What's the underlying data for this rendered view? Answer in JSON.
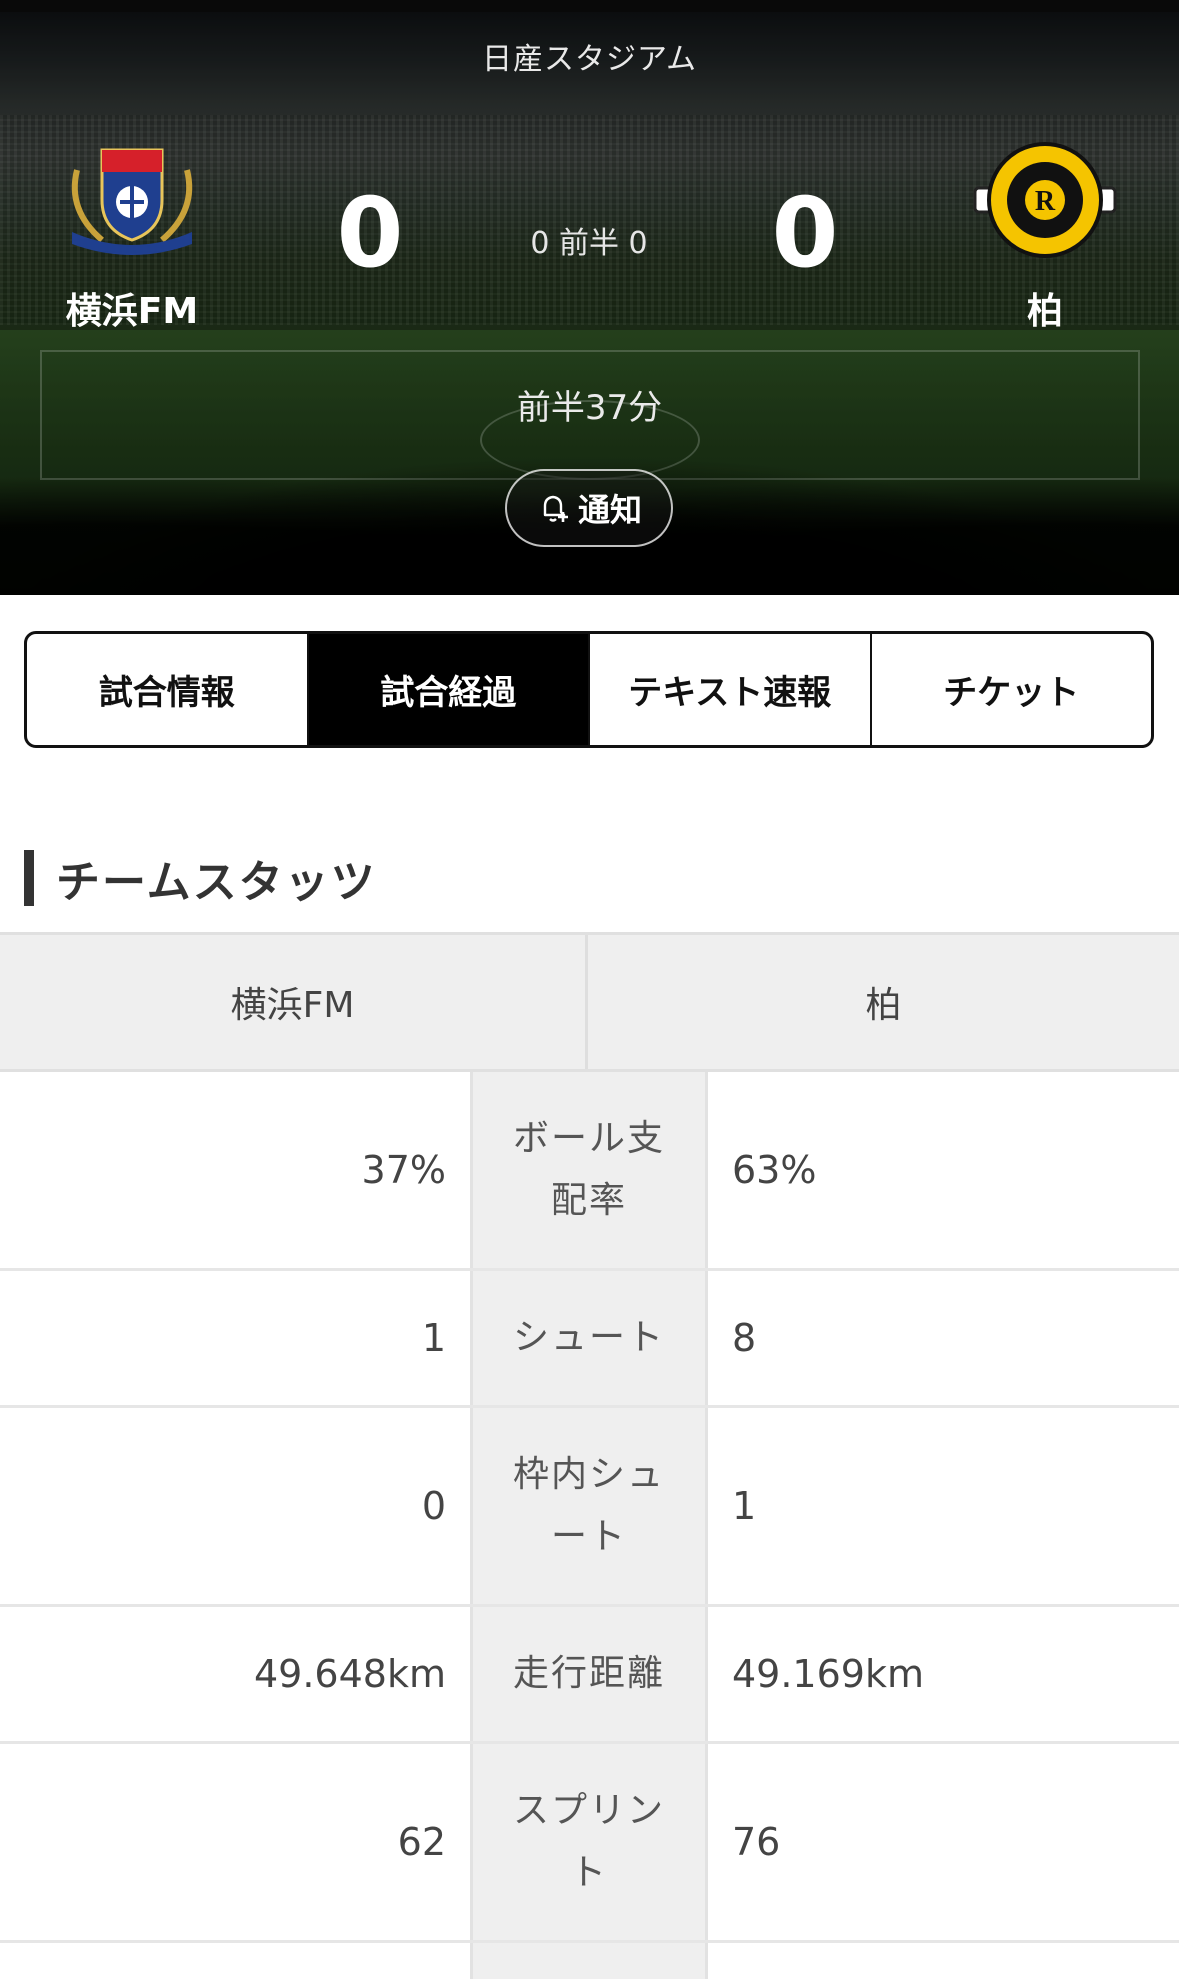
{
  "match": {
    "venue": "日産スタジアム",
    "home_team": {
      "name": "横浜FM",
      "score": "0",
      "half_score": "0",
      "logo_icon": "yokohama-f-marinos-crest-icon"
    },
    "away_team": {
      "name": "柏",
      "score": "0",
      "half_score": "0",
      "logo_icon": "kashiwa-reysol-crest-icon"
    },
    "half_label": "前半",
    "match_time": "前半37分",
    "notify_label": "通知"
  },
  "tabs": [
    {
      "label": "試合情報",
      "active": false
    },
    {
      "label": "試合経過",
      "active": true
    },
    {
      "label": "テキスト速報",
      "active": false
    },
    {
      "label": "チケット",
      "active": false
    }
  ],
  "stats": {
    "title": "チームスタッツ",
    "home_header": "横浜FM",
    "away_header": "柏",
    "rows": [
      {
        "label": "ボール支配率",
        "home": "37%",
        "away": "63%"
      },
      {
        "label": "シュート",
        "home": "1",
        "away": "8"
      },
      {
        "label": "枠内シュート",
        "home": "0",
        "away": "1"
      },
      {
        "label": "走行距離",
        "home": "49.648km",
        "away": "49.169km"
      },
      {
        "label": "スプリント",
        "home": "62",
        "away": "76"
      }
    ]
  },
  "colors": {
    "active_tab_bg": "#000000",
    "stats_label_bg": "#efefef",
    "kashiwa_yellow": "#f5c400",
    "marinos_blue": "#1f3f8f",
    "marinos_red": "#d6202a"
  }
}
